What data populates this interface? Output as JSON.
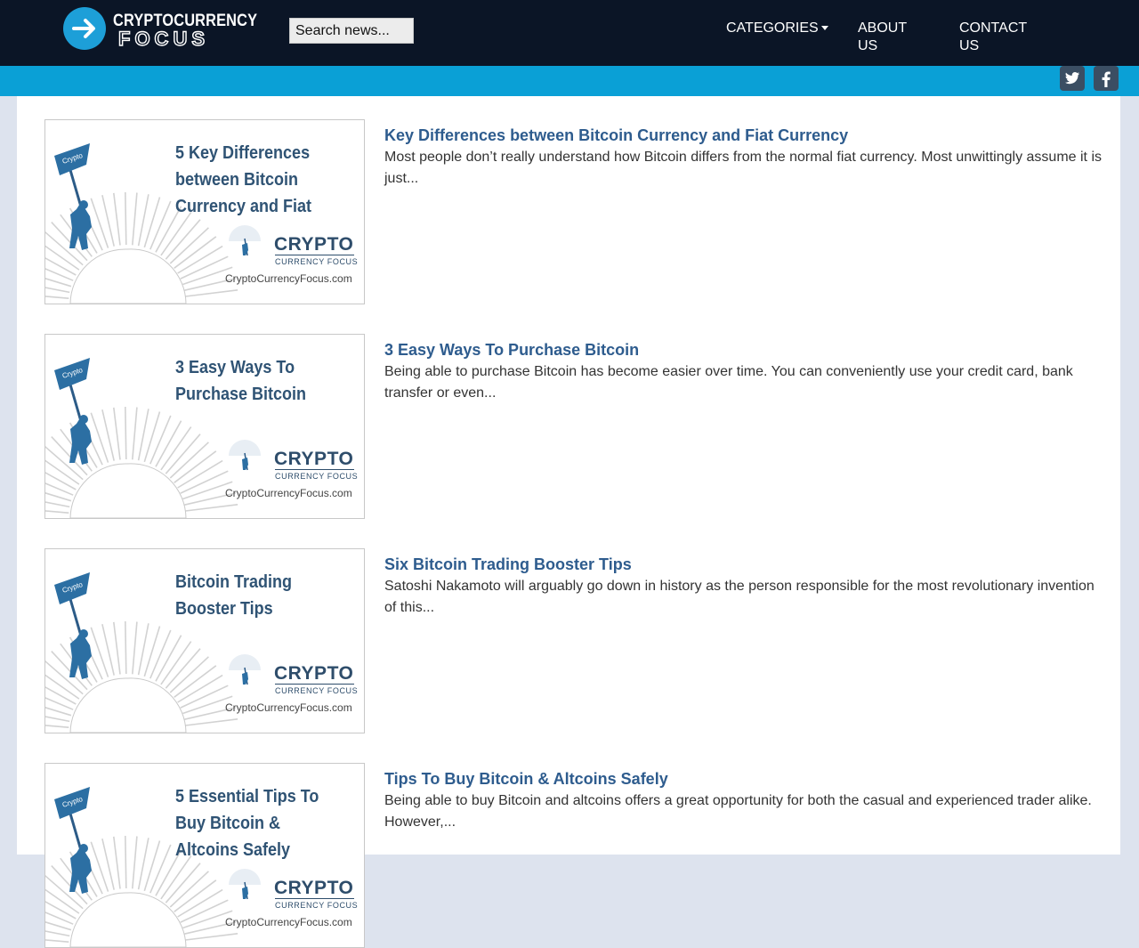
{
  "header": {
    "logo_line1": "CRYPTOCURRENCY",
    "logo_line2": "FOCUS",
    "search_placeholder": "Search news...",
    "nav": {
      "categories": "CATEGORIES",
      "about": "ABOUT US",
      "contact": "CONTACT US"
    }
  },
  "social": {
    "twitter_icon": "twitter-icon",
    "facebook_icon": "facebook-icon"
  },
  "colors": {
    "header_bg": "#0b1526",
    "accent_bar": "#0aa0d6",
    "title_link": "#2e5c8e",
    "thumb_text": "#2f5374"
  },
  "posts": [
    {
      "thumb_title": "5 Key Differences between Bitcoin Currency and Fiat",
      "thumb_flag": "Crypto",
      "thumb_brand": "CRYPTO",
      "thumb_brand_sub": "CURRENCY FOCUS",
      "thumb_url": "CryptoCurrencyFocus.com",
      "title": "Key Differences between Bitcoin Currency and Fiat Currency",
      "excerpt": "Most people don’t really understand how Bitcoin differs from the normal fiat currency. Most unwittingly assume it is just..."
    },
    {
      "thumb_title": "3 Easy Ways To Purchase Bitcoin",
      "thumb_flag": "Crypto",
      "thumb_brand": "CRYPTO",
      "thumb_brand_sub": "CURRENCY FOCUS",
      "thumb_url": "CryptoCurrencyFocus.com",
      "title": "3 Easy Ways To Purchase Bitcoin",
      "excerpt": "Being able to purchase Bitcoin has become easier over time. You can conveniently use your credit card, bank transfer or even..."
    },
    {
      "thumb_title": "Bitcoin Trading Booster Tips",
      "thumb_flag": "Crypto",
      "thumb_brand": "CRYPTO",
      "thumb_brand_sub": "CURRENCY FOCUS",
      "thumb_url": "CryptoCurrencyFocus.com",
      "title": "Six Bitcoin Trading Booster Tips",
      "excerpt": "Satoshi Nakamoto will arguably go down in history as the person responsible for the most revolutionary invention of this..."
    },
    {
      "thumb_title": "5 Essential Tips To Buy Bitcoin & Altcoins Safely",
      "thumb_flag": "Crypto",
      "thumb_brand": "CRYPTO",
      "thumb_brand_sub": "CURRENCY FOCUS",
      "thumb_url": "CryptoCurrencyFocus.com",
      "title": "Tips To Buy Bitcoin & Altcoins Safely",
      "excerpt": "Being able to buy Bitcoin and altcoins offers a great opportunity for both the casual and experienced trader alike. However,..."
    }
  ]
}
